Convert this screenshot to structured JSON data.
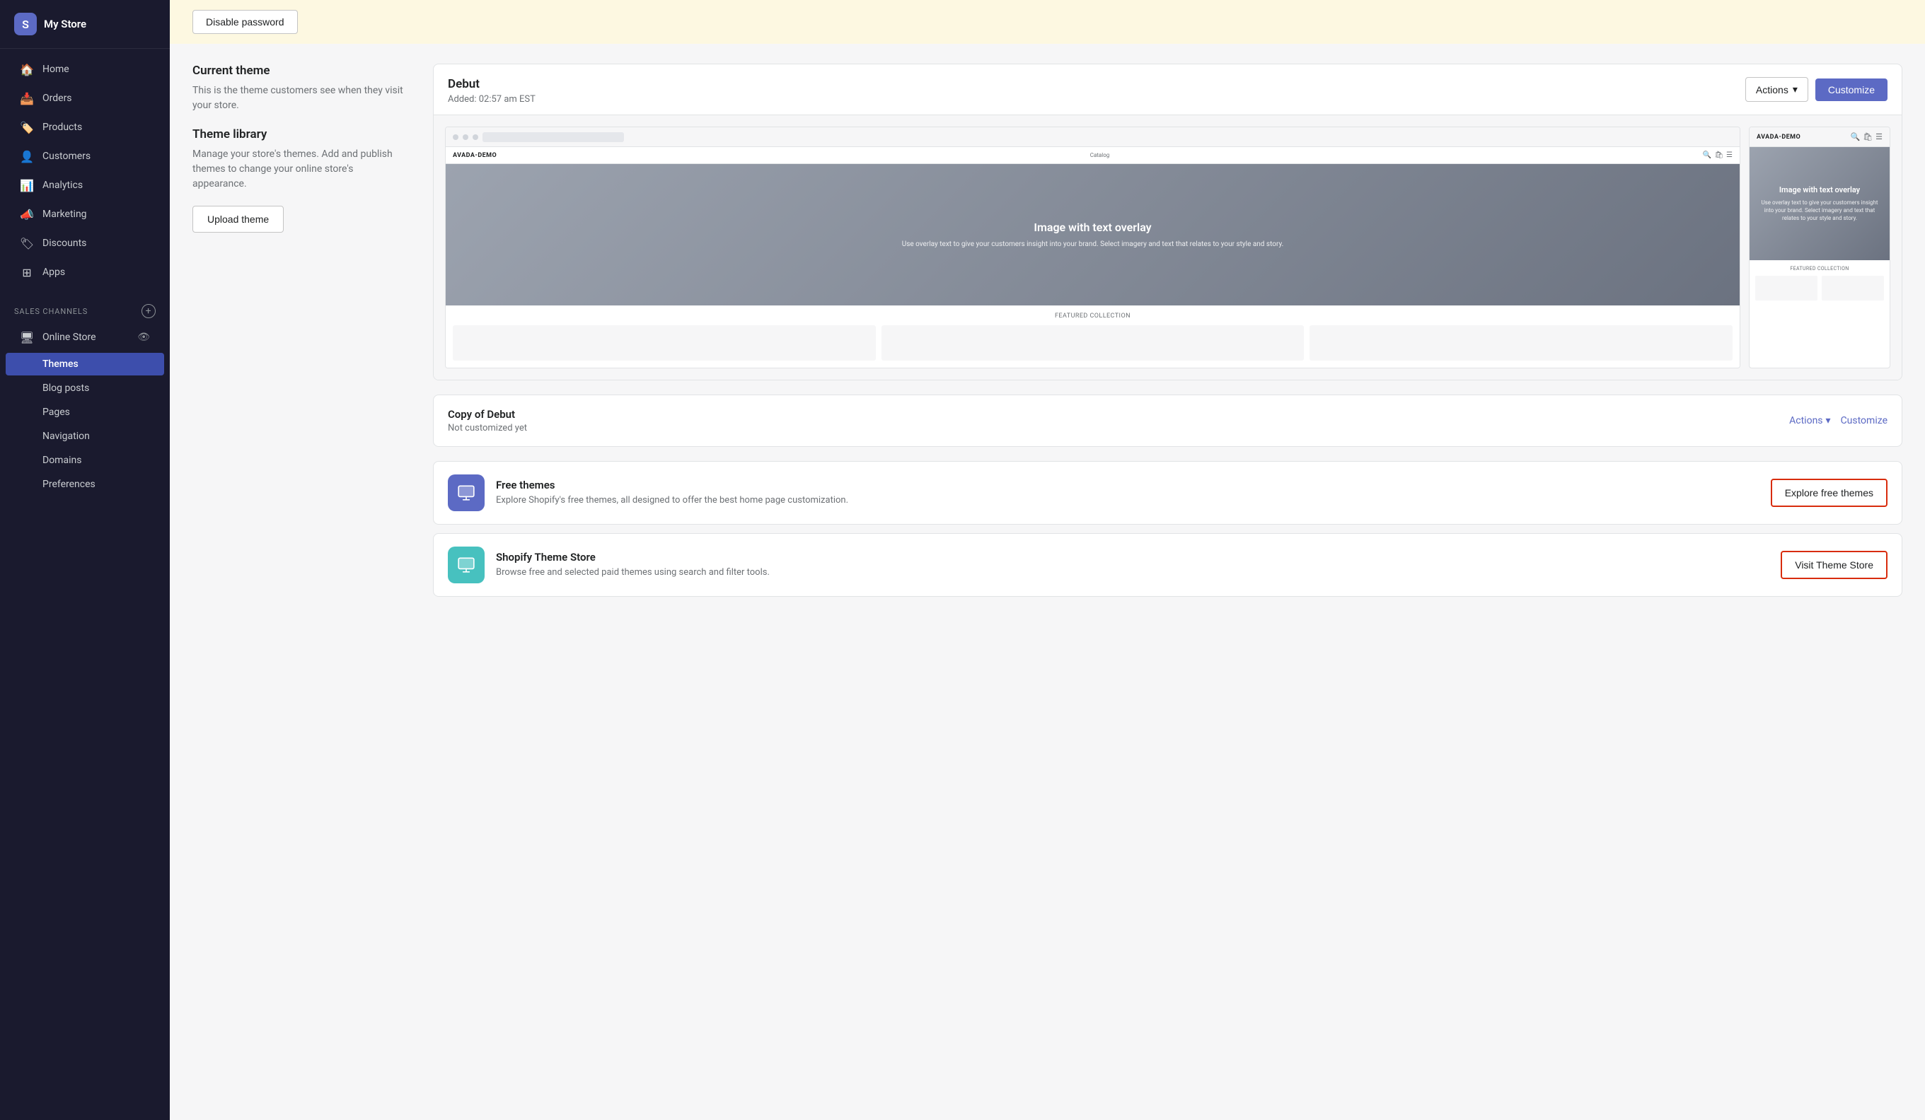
{
  "sidebar": {
    "store_name": "My Store",
    "nav_items": [
      {
        "id": "home",
        "label": "Home",
        "icon": "🏠"
      },
      {
        "id": "orders",
        "label": "Orders",
        "icon": "📥"
      },
      {
        "id": "products",
        "label": "Products",
        "icon": "🏷️"
      },
      {
        "id": "customers",
        "label": "Customers",
        "icon": "👤"
      },
      {
        "id": "analytics",
        "label": "Analytics",
        "icon": "📊"
      },
      {
        "id": "marketing",
        "label": "Marketing",
        "icon": "📣"
      },
      {
        "id": "discounts",
        "label": "Discounts",
        "icon": "🏷"
      },
      {
        "id": "apps",
        "label": "Apps",
        "icon": "⊞"
      }
    ],
    "sales_channels_label": "SALES CHANNELS",
    "online_store_label": "Online Store",
    "sub_items": [
      {
        "id": "themes",
        "label": "Themes",
        "active": true
      },
      {
        "id": "blog-posts",
        "label": "Blog posts",
        "active": false
      },
      {
        "id": "pages",
        "label": "Pages",
        "active": false
      },
      {
        "id": "navigation",
        "label": "Navigation",
        "active": false
      },
      {
        "id": "domains",
        "label": "Domains",
        "active": false
      },
      {
        "id": "preferences",
        "label": "Preferences",
        "active": false
      }
    ]
  },
  "password_bar": {
    "button_label": "Disable password"
  },
  "current_theme_section": {
    "title": "Current theme",
    "description": "This is the theme customers see when they visit your store."
  },
  "theme_card": {
    "name": "Debut",
    "added": "Added: 02:57 am EST",
    "actions_label": "Actions",
    "customize_label": "Customize",
    "preview": {
      "desktop": {
        "brand": "AVADA-DEMO",
        "nav_link": "Catalog",
        "overlay_title": "Image with text overlay",
        "overlay_sub": "Use overlay text to give your customers insight into your brand. Select imagery and text that relates to your style and story.",
        "featured_label": "FEATURED COLLECTION"
      },
      "mobile": {
        "brand": "AVADA-DEMO",
        "overlay_title": "Image with text overlay",
        "overlay_sub": "Use overlay text to give your customers insight into your brand. Select imagery and text that relates to your style and story.",
        "featured_label": "FEATURED COLLECTION"
      }
    }
  },
  "theme_library_section": {
    "title": "Theme library",
    "description": "Manage your store's themes. Add and publish themes to change your online store's appearance.",
    "upload_btn_label": "Upload theme"
  },
  "copy_card": {
    "name": "Copy of Debut",
    "status": "Not customized yet",
    "actions_label": "Actions",
    "customize_label": "Customize"
  },
  "free_themes_card": {
    "title": "Free themes",
    "description": "Explore Shopify's free themes, all designed to offer the best home page customization.",
    "button_label": "Explore free themes",
    "icon": "📋"
  },
  "theme_store_card": {
    "title": "Shopify Theme Store",
    "description": "Browse free and selected paid themes using search and filter tools.",
    "button_label": "Visit Theme Store",
    "icon": "📋"
  }
}
